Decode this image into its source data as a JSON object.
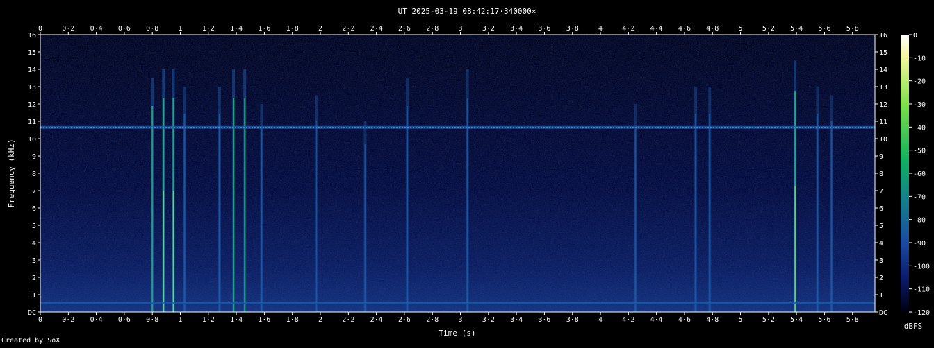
{
  "chart_data": {
    "type": "heatmap",
    "title": "UT 2025-03-19 08:42:17·340000×",
    "xlabel": "Time (s)",
    "ylabel": "Frequency (kHz)",
    "xlim": [
      0,
      5.96
    ],
    "ylim": [
      0,
      16
    ],
    "x_ticks": [
      "0",
      "0·2",
      "0·4",
      "0·6",
      "0·8",
      "1",
      "1·2",
      "1·4",
      "1·6",
      "1·8",
      "2",
      "2·2",
      "2·4",
      "2·6",
      "2·8",
      "3",
      "3·2",
      "3·4",
      "3·6",
      "3·8",
      "4",
      "4·2",
      "4·4",
      "4·6",
      "4·8",
      "5",
      "5·2",
      "5·4",
      "5·6",
      "5·8"
    ],
    "y_ticks": [
      "DC",
      "1",
      "2",
      "3",
      "4",
      "5",
      "6",
      "7",
      "8",
      "9",
      "10",
      "11",
      "12",
      "13",
      "14",
      "15",
      "16"
    ],
    "colorbar": {
      "label": "dBFS",
      "range": [
        -120,
        0
      ],
      "ticks": [
        "0",
        "-10",
        "-20",
        "-30",
        "-40",
        "-50",
        "-60",
        "-70",
        "-80",
        "-90",
        "-100",
        "-110",
        "-120"
      ]
    },
    "grid": false,
    "footer": "Created by SoX",
    "colors": {
      "background": "#000000",
      "noise_floor": "#02022a",
      "low": "#0a1f6e",
      "mid": "#1f5fb0",
      "high": "#23b37a",
      "peak": "#7fe05a"
    },
    "tone_band_khz": 10.65,
    "transients": [
      {
        "t": 0.8,
        "f_max": 13.5,
        "level": 0.75
      },
      {
        "t": 0.88,
        "f_max": 14.0,
        "level": 1.0
      },
      {
        "t": 0.95,
        "f_max": 14.0,
        "level": 0.9
      },
      {
        "t": 1.03,
        "f_max": 13.0,
        "level": 0.55
      },
      {
        "t": 1.28,
        "f_max": 13.0,
        "level": 0.65
      },
      {
        "t": 1.38,
        "f_max": 14.0,
        "level": 0.8
      },
      {
        "t": 1.46,
        "f_max": 14.0,
        "level": 0.85
      },
      {
        "t": 1.58,
        "f_max": 12.0,
        "level": 0.55
      },
      {
        "t": 1.97,
        "f_max": 12.5,
        "level": 0.45
      },
      {
        "t": 2.32,
        "f_max": 11.0,
        "level": 0.4
      },
      {
        "t": 2.62,
        "f_max": 13.5,
        "level": 0.5
      },
      {
        "t": 3.05,
        "f_max": 14.0,
        "level": 0.5
      },
      {
        "t": 4.25,
        "f_max": 12.0,
        "level": 0.4
      },
      {
        "t": 4.68,
        "f_max": 13.0,
        "level": 0.5
      },
      {
        "t": 4.78,
        "f_max": 13.0,
        "level": 0.45
      },
      {
        "t": 5.39,
        "f_max": 14.5,
        "level": 0.9
      },
      {
        "t": 5.55,
        "f_max": 13.0,
        "level": 0.45
      },
      {
        "t": 5.65,
        "f_max": 12.5,
        "level": 0.4
      }
    ]
  }
}
